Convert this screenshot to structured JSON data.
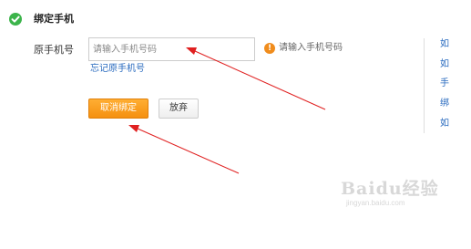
{
  "section": {
    "title": "绑定手机",
    "icon": "check-circle-icon"
  },
  "form": {
    "label": "原手机号",
    "input_placeholder": "请输入手机号码",
    "input_value": "",
    "hint": "请输入手机号码",
    "forgot_link": "忘记原手机号"
  },
  "buttons": {
    "cancel_bind": "取消绑定",
    "give_up": "放弃"
  },
  "sidebar_links": [
    "如",
    "如",
    "手",
    "绑",
    "如"
  ],
  "watermark": {
    "logo": "Baidu经验",
    "url": "jingyan.baidu.com"
  },
  "colors": {
    "primary_button": "#f5900f",
    "link": "#2a6bbf",
    "success": "#3cb44b",
    "warning": "#f08c1c",
    "annotation_arrow": "#e02020"
  }
}
